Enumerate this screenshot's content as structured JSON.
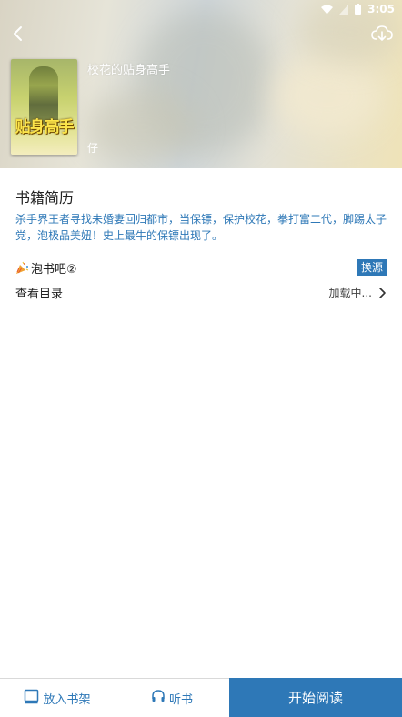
{
  "status_bar": {
    "time": "3:05"
  },
  "book": {
    "title": "校花的贴身高手",
    "author_initial": "仔",
    "cover_art_title": "贴身高手"
  },
  "intro": {
    "heading": "书籍简历",
    "text": "杀手界王者寻找未婚妻回归都市，当保镖，保护校花，拳打富二代，脚踢太子党，泡极品美妞！史上最牛的保镖出现了。"
  },
  "source": {
    "name": "泡书吧②",
    "switch_label": "换源"
  },
  "toc": {
    "label": "查看目录",
    "status": "加载中..."
  },
  "bottom": {
    "shelf_label": "放入书架",
    "listen_label": "听书",
    "read_label": "开始阅读"
  },
  "colors": {
    "accent": "#2e78b7",
    "text": "#222222"
  },
  "icons": [
    "back-arrow-icon",
    "cloud-download-icon",
    "wifi-icon",
    "signal-icon",
    "battery-icon",
    "party-popper-icon",
    "chevron-right-icon",
    "tablet-icon",
    "headphones-icon"
  ]
}
